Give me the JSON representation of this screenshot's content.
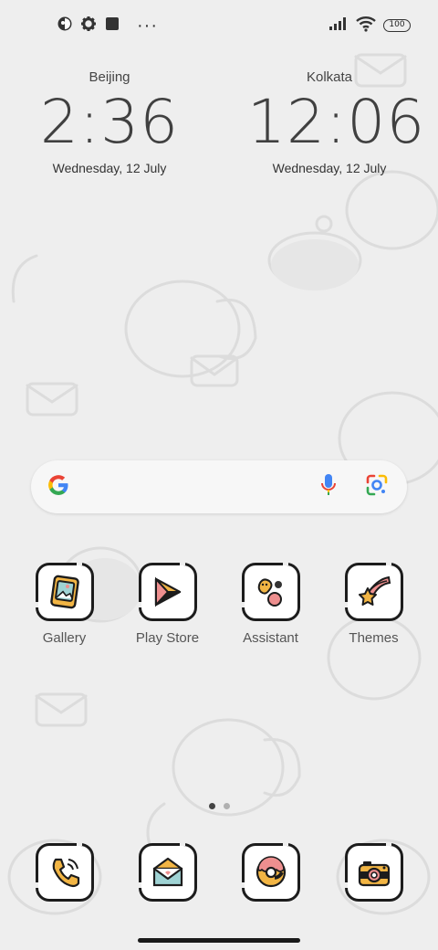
{
  "status_bar": {
    "left_icons": [
      "circle-status-icon",
      "gear-icon",
      "square-icon",
      "more-dots-icon"
    ],
    "more_text": "···",
    "right_icons": [
      "signal-icon",
      "wifi-icon",
      "battery-icon"
    ],
    "battery_level": "100"
  },
  "clocks": [
    {
      "city": "Beijing",
      "time": "2:36",
      "date": "Wednesday, 12 July"
    },
    {
      "city": "Kolkata",
      "time": "12:06",
      "date": "Wednesday, 12 July"
    }
  ],
  "search_bar": {
    "icons": [
      "google-logo-icon",
      "microphone-icon",
      "google-lens-icon"
    ]
  },
  "apps": [
    {
      "label": "Gallery",
      "icon": "gallery-icon"
    },
    {
      "label": "Play Store",
      "icon": "play-store-icon"
    },
    {
      "label": "Assistant",
      "icon": "assistant-icon"
    },
    {
      "label": "Themes",
      "icon": "themes-star-icon"
    }
  ],
  "dock": [
    {
      "icon": "phone-icon"
    },
    {
      "icon": "messages-envelope-icon"
    },
    {
      "icon": "browser-donut-icon"
    },
    {
      "icon": "camera-icon"
    }
  ],
  "page_indicator": {
    "pages": 2,
    "current": 1
  },
  "colors": {
    "background": "#eeeeee",
    "icon_outline": "#1c1c1c",
    "icon_yellow": "#f2b544",
    "icon_pink": "#ee8f8f",
    "icon_teal": "#9fd3d4"
  }
}
